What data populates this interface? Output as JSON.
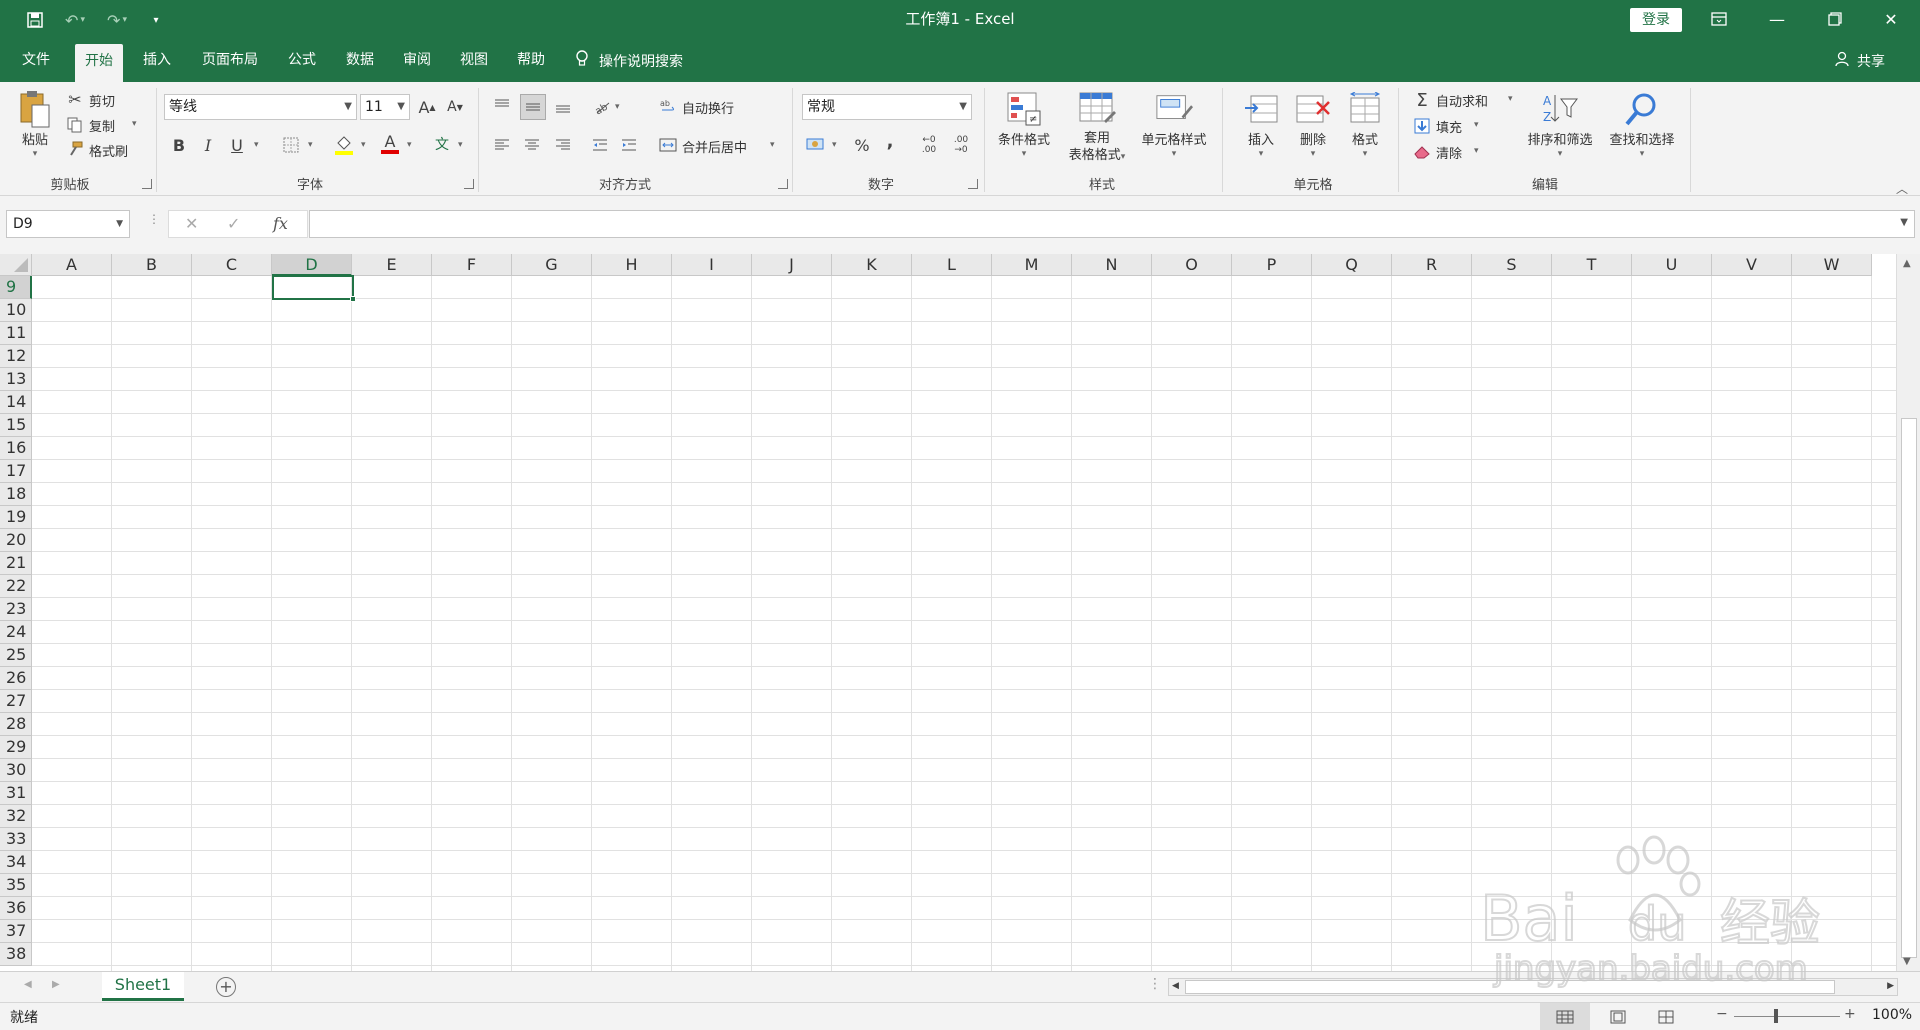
{
  "titlebar": {
    "title": "工作簿1  -  Excel",
    "login": "登录"
  },
  "tabs": [
    {
      "label": "文件"
    },
    {
      "label": "开始"
    },
    {
      "label": "插入"
    },
    {
      "label": "页面布局"
    },
    {
      "label": "公式"
    },
    {
      "label": "数据"
    },
    {
      "label": "审阅"
    },
    {
      "label": "视图"
    },
    {
      "label": "帮助"
    }
  ],
  "tell_me": "操作说明搜索",
  "share": "共享",
  "ribbon": {
    "clipboard": {
      "paste": "粘贴",
      "cut": "剪切",
      "copy": "复制",
      "format_painter": "格式刷",
      "label": "剪贴板"
    },
    "font": {
      "name": "等线",
      "size": "11",
      "grow": "A",
      "shrink": "A",
      "bold": "B",
      "italic": "I",
      "underline": "U",
      "color_glyph": "A",
      "phonetic": "文",
      "label": "字体"
    },
    "alignment": {
      "wrap": "自动换行",
      "merge": "合并后居中",
      "label": "对齐方式"
    },
    "number": {
      "format": "常规",
      "percent": "%",
      "comma": ",",
      "inc_dec": ".00",
      "dec_dec": ".00",
      "label": "数字"
    },
    "styles": {
      "conditional": "条件格式",
      "table_1": "套用",
      "table_2": "表格格式",
      "cell_styles": "单元格样式",
      "label": "样式"
    },
    "cells": {
      "insert": "插入",
      "delete": "删除",
      "format": "格式",
      "label": "单元格"
    },
    "editing": {
      "autosum": "自动求和",
      "fill": "填充",
      "clear": "清除",
      "sort": "排序和筛选",
      "find": "查找和选择",
      "label": "编辑"
    }
  },
  "formula_bar": {
    "name_box": "D9",
    "fx": "fx",
    "cancel": "✕",
    "enter": "✓"
  },
  "grid": {
    "columns": [
      "A",
      "B",
      "C",
      "D",
      "E",
      "F",
      "G",
      "H",
      "I",
      "J",
      "K",
      "L",
      "M",
      "N",
      "O",
      "P",
      "Q",
      "R",
      "S",
      "T",
      "U",
      "V",
      "W"
    ],
    "rows": [
      "9",
      "10",
      "11",
      "12",
      "13",
      "14",
      "15",
      "16",
      "17",
      "18",
      "19",
      "20",
      "21",
      "22",
      "23",
      "24",
      "25",
      "26",
      "27",
      "28",
      "29",
      "30",
      "31",
      "32",
      "33",
      "34",
      "35",
      "36",
      "37",
      "38"
    ],
    "selected_col": "D",
    "selected_row": "9"
  },
  "sheets": [
    {
      "name": "Sheet1"
    }
  ],
  "status": {
    "ready": "就绪",
    "zoom": "100%",
    "zoom_minus": "−",
    "zoom_plus": "+"
  },
  "colors": {
    "accent": "#217346"
  }
}
